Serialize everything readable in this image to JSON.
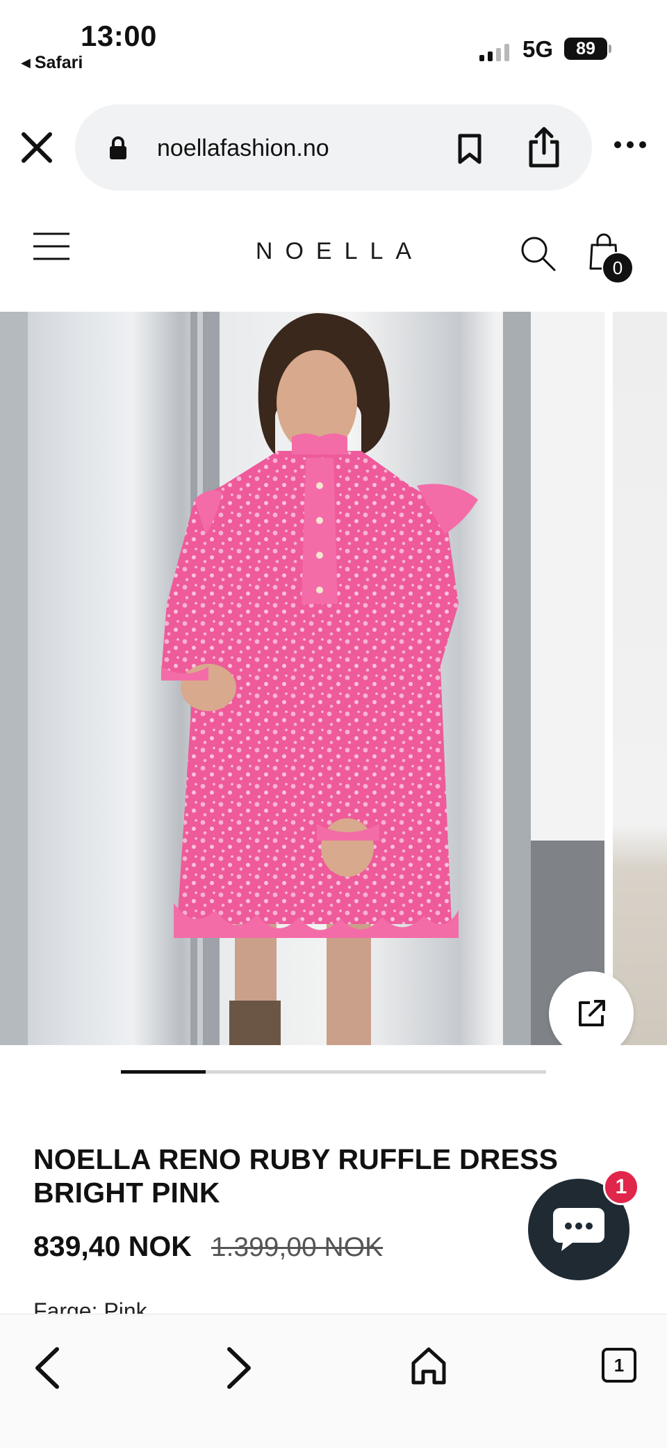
{
  "status_bar": {
    "time": "13:00",
    "back_app": "Safari",
    "network": "5G",
    "battery": "89"
  },
  "browser": {
    "url": "noellafashion.no",
    "open_tabs": "1"
  },
  "site": {
    "brand": "NOELLA",
    "cart_count": "0"
  },
  "gallery": {
    "progress": 0.2
  },
  "product": {
    "title": "NOELLA RENO RUBY RUFFLE DRESS BRIGHT PINK",
    "sale_price": "839,40 NOK",
    "original_price": "1.399,00 NOK",
    "color_label": "Farge: Pink"
  },
  "chat": {
    "unread": "1"
  },
  "colors": {
    "accent": "#e0264a",
    "chat_bg": "#1f2a33",
    "dress_pink": "#f05a9a"
  },
  "icons": [
    "close-icon",
    "lock-icon",
    "bookmark-icon",
    "share-icon",
    "more-icon",
    "hamburger-icon",
    "search-icon",
    "cart-icon",
    "external-link-icon",
    "chat-icon",
    "back-icon",
    "forward-icon",
    "home-icon",
    "tabs-icon"
  ]
}
